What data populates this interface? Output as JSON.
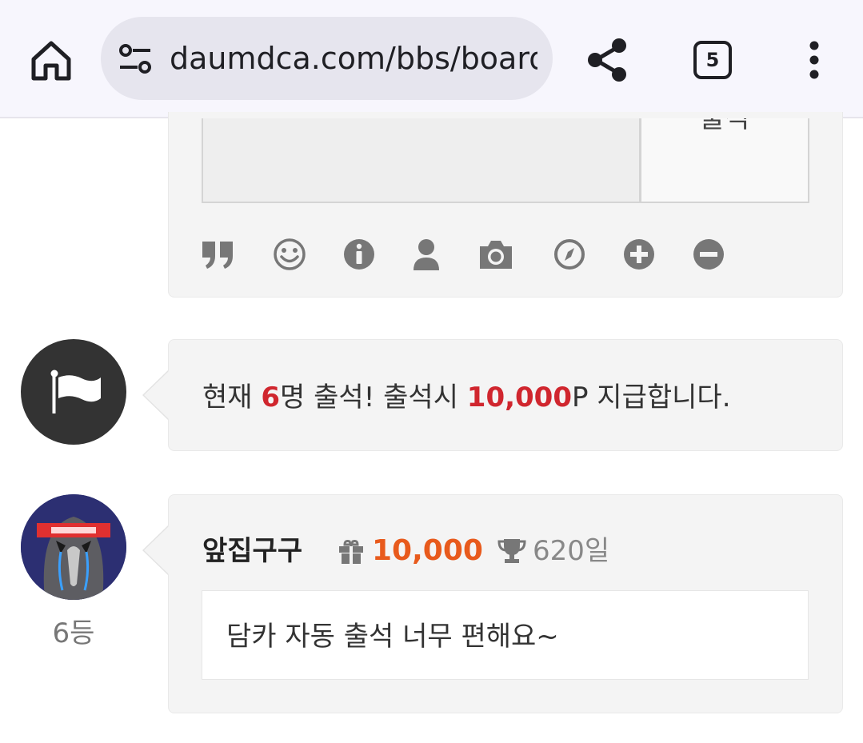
{
  "browser": {
    "url": "daumdca.com/bbs/board",
    "tab_count": "5",
    "icons": [
      "home-icon",
      "site-settings-icon",
      "share-icon",
      "tab-switcher-icon",
      "more-menu-icon"
    ]
  },
  "comment_form": {
    "submit_label": "출석",
    "toolbar_icons": [
      "quote-icon",
      "smiley-icon",
      "info-icon",
      "user-icon",
      "camera-icon",
      "compass-icon",
      "plus-icon",
      "minus-icon"
    ]
  },
  "notice": {
    "prefix": "현재 ",
    "count": "6",
    "middle": "명 출석! 출석시 ",
    "points": "10,000",
    "suffix": "P 지급합니다."
  },
  "entry": {
    "username": "앞집구구",
    "points": "10,000",
    "days": "620일",
    "rank": "6등",
    "comment": "담카 자동 출석 너무 편해요~"
  },
  "colors": {
    "accent_red": "#d0262e",
    "accent_orange": "#e85a1c",
    "panel_bg": "#f4f4f4",
    "icon_gray": "#777777"
  }
}
